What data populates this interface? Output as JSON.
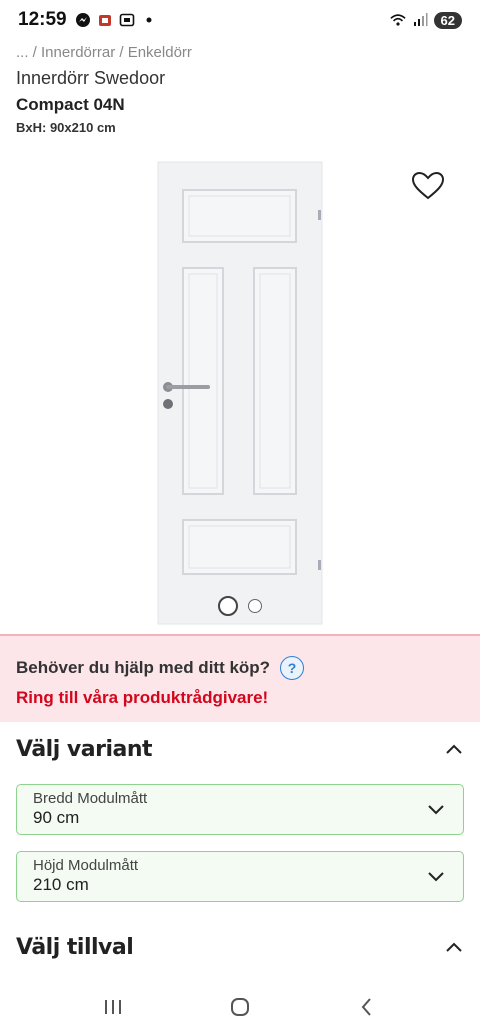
{
  "status_bar": {
    "time": "12:59",
    "battery": "62"
  },
  "breadcrumb": "... / Innerdörrar / Enkeldörr",
  "product": {
    "brand_line": "Innerdörr Swedoor",
    "name": "Compact 04N",
    "dimensions": "BxH: 90x210 cm"
  },
  "gallery": {
    "image_count": 2,
    "active_index": 0
  },
  "help": {
    "title": "Behöver du hjälp med ditt köp?",
    "question_mark": "?",
    "link": "Ring till våra produktrådgivare!"
  },
  "variant_section": {
    "title": "Välj variant",
    "selects": [
      {
        "label": "Bredd Modulmått",
        "value": "90 cm"
      },
      {
        "label": "Höjd Modulmått",
        "value": "210 cm"
      }
    ]
  },
  "addon_section": {
    "title": "Välj tillval"
  },
  "icons": {
    "favorite": "heart-icon",
    "expand": "chevron-up-icon",
    "dropdown": "chevron-down-icon",
    "nav_recent": "recent-apps-icon",
    "nav_home": "home-icon",
    "nav_back": "back-icon"
  },
  "colors": {
    "accent_red": "#d4051c",
    "help_bg": "#fce6e9",
    "select_border": "#8fd18f",
    "select_bg": "#f3fbf2"
  }
}
